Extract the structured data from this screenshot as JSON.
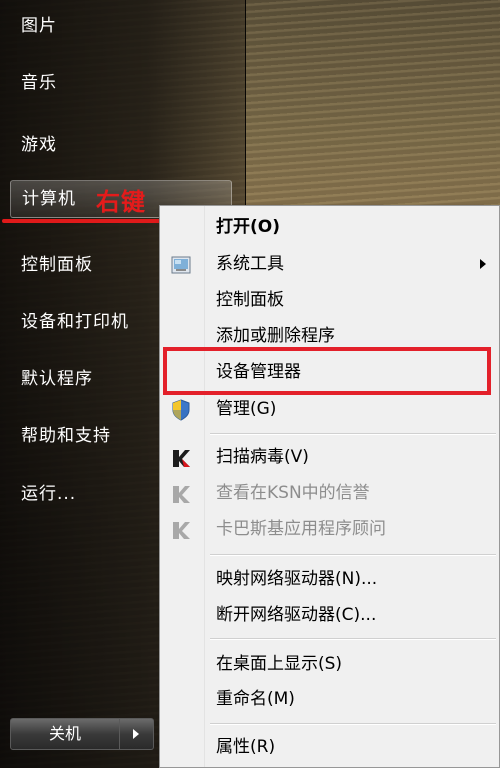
{
  "start_menu": {
    "items": [
      {
        "label": "图片"
      },
      {
        "label": "音乐"
      },
      {
        "label": "游戏"
      },
      {
        "label": "计算机"
      },
      {
        "label": "控制面板"
      },
      {
        "label": "设备和打印机"
      },
      {
        "label": "默认程序"
      },
      {
        "label": "帮助和支持"
      },
      {
        "label": "运行..."
      }
    ],
    "shutdown_label": "关机"
  },
  "annotation": {
    "label": "右键",
    "color": "#e41b1b"
  },
  "context_menu": {
    "items": [
      {
        "label": "打开(O)",
        "icon": ""
      },
      {
        "label": "系统工具",
        "icon": "system-tools-icon"
      },
      {
        "label": "控制面板",
        "icon": ""
      },
      {
        "label": "添加或删除程序",
        "icon": ""
      },
      {
        "label": "设备管理器",
        "icon": ""
      },
      {
        "label": "管理(G)",
        "icon": "uac-shield-icon"
      },
      {
        "label": "扫描病毒(V)",
        "icon": "kaspersky-icon"
      },
      {
        "label": "查看在KSN中的信誉",
        "icon": "kaspersky-icon"
      },
      {
        "label": "卡巴斯基应用程序顾问",
        "icon": "kaspersky-icon"
      },
      {
        "label": "映射网络驱动器(N)...",
        "icon": ""
      },
      {
        "label": "断开网络驱动器(C)...",
        "icon": ""
      },
      {
        "label": "在桌面上显示(S)",
        "icon": ""
      },
      {
        "label": "重命名(M)",
        "icon": ""
      },
      {
        "label": "属性(R)",
        "icon": ""
      }
    ],
    "highlight_color": "#e3202a"
  }
}
